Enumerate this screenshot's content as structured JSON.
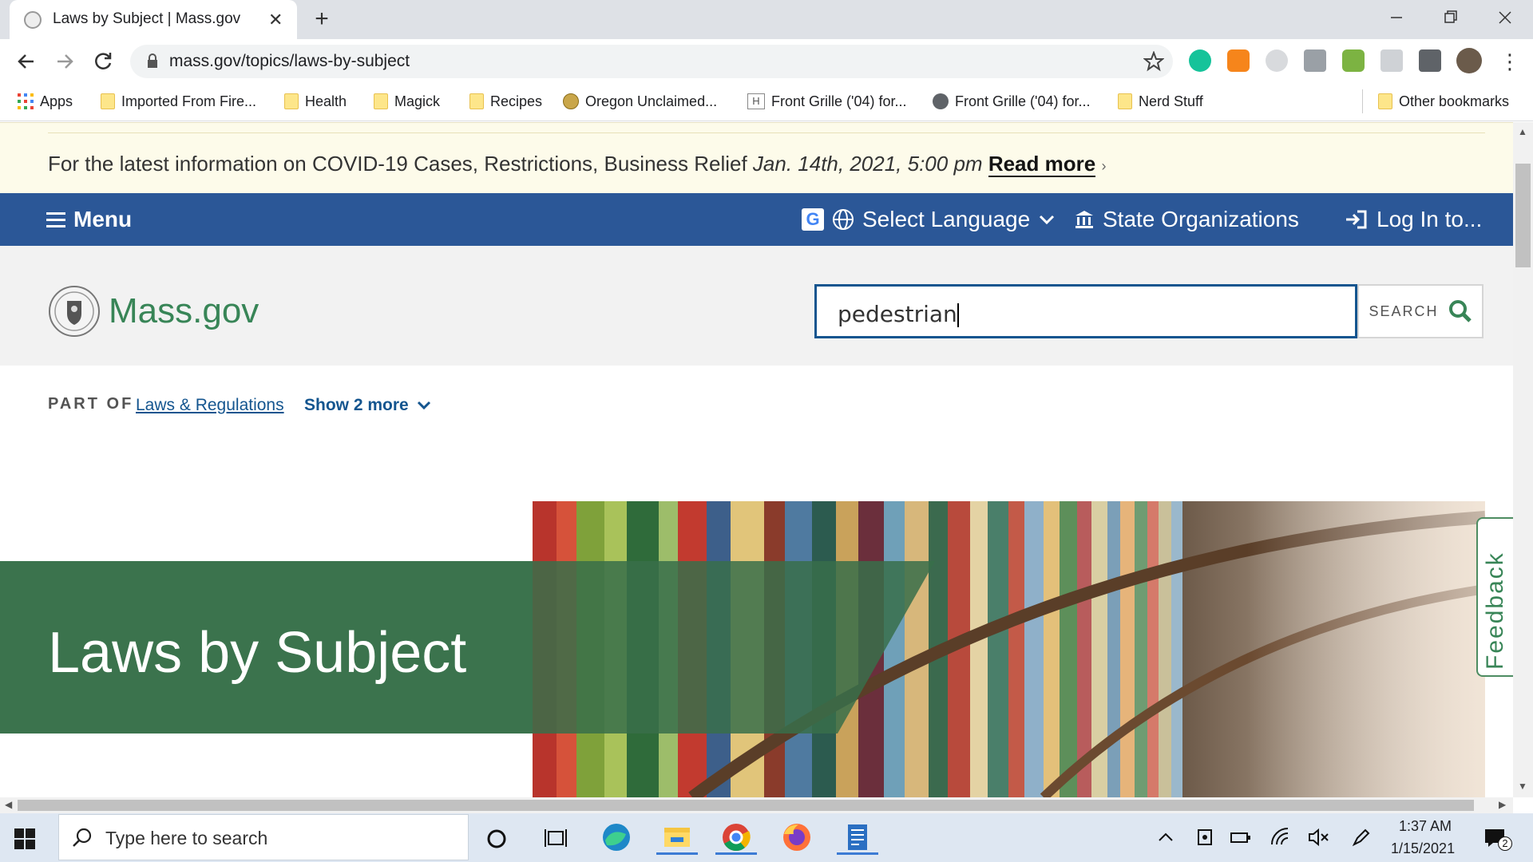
{
  "browser": {
    "tab_title": "Laws by Subject | Mass.gov",
    "url": "mass.gov/topics/laws-by-subject",
    "bookmarks": [
      {
        "label": "Apps",
        "icon": "apps-grid-icon"
      },
      {
        "label": "Imported From Fire...",
        "icon": "folder-icon"
      },
      {
        "label": "Health",
        "icon": "folder-icon"
      },
      {
        "label": "Magick",
        "icon": "folder-icon"
      },
      {
        "label": "Recipes",
        "icon": "folder-icon"
      },
      {
        "label": "Oregon Unclaimed...",
        "icon": "site-icon"
      },
      {
        "label": "Front Grille ('04) for...",
        "icon": "site-icon"
      },
      {
        "label": "Front Grille ('04) for...",
        "icon": "globe-icon"
      },
      {
        "label": "Nerd Stuff",
        "icon": "folder-icon"
      }
    ],
    "other_bookmarks": "Other bookmarks"
  },
  "page": {
    "covid": {
      "text": "For the latest information on COVID-19 Cases, Restrictions, Business Relief",
      "date": "Jan. 14th, 2021, 5:00 pm",
      "link": "Read more"
    },
    "nav": {
      "menu": "Menu",
      "language": "Select Language",
      "state_orgs": "State Organizations",
      "login": "Log In to..."
    },
    "site_name": "Mass.gov",
    "search": {
      "value": "pedestrian",
      "button": "SEARCH"
    },
    "breadcrumb": {
      "part_of": "PART OF",
      "link": "Laws & Regulations",
      "show_more": "Show 2 more"
    },
    "hero_title": "Laws by Subject",
    "feedback": "Feedback"
  },
  "taskbar": {
    "search_placeholder": "Type here to search",
    "time": "1:37 AM",
    "date": "1/15/2021",
    "notification_count": "2"
  },
  "colors": {
    "nav_blue": "#2b5797",
    "brand_green": "#388557",
    "link_blue": "#14558f",
    "covid_bg": "#fdfbea"
  }
}
